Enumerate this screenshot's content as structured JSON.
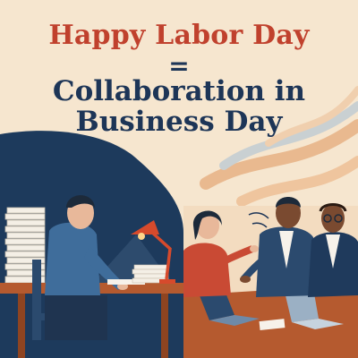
{
  "poster": {
    "title_line1": "Happy Labor Day",
    "equals": "=",
    "title_line2": "Collaboration in",
    "title_line3": "Business Day"
  },
  "colors": {
    "background": "#f6e6cf",
    "title_red": "#c0412d",
    "navy": "#1d3557",
    "desk_wood": "#b55a2f",
    "lamp_red": "#d64a2c"
  },
  "illustration": {
    "left_scene": "person-working-alone-at-desk",
    "right_scene": "team-collaborating-at-table"
  }
}
